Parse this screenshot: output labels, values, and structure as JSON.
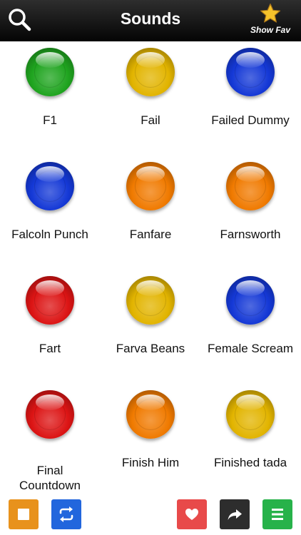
{
  "header": {
    "title": "Sounds",
    "show_fav_label": "Show Fav"
  },
  "colors": {
    "green": "#1fa41f",
    "yellow": "#e2b400",
    "blue": "#1438d6",
    "orange": "#f07a00",
    "red": "#dc1414",
    "stop_button": "#e8921c",
    "repeat_button": "#2266dd",
    "favorite_button": "#e84a4a",
    "share_button": "#2d2d2d",
    "menu_button": "#27b24a"
  },
  "sounds": [
    {
      "name": "F1",
      "color": "green"
    },
    {
      "name": "Fail",
      "color": "yellow"
    },
    {
      "name": "Failed Dummy",
      "color": "blue"
    },
    {
      "name": "Falcoln Punch",
      "color": "blue"
    },
    {
      "name": "Fanfare",
      "color": "orange"
    },
    {
      "name": "Farnsworth",
      "color": "orange"
    },
    {
      "name": "Fart",
      "color": "red"
    },
    {
      "name": "Farva Beans",
      "color": "yellow"
    },
    {
      "name": "Female Scream",
      "color": "blue"
    },
    {
      "name": "Final Countdown",
      "color": "red"
    },
    {
      "name": "Finish Him",
      "color": "orange"
    },
    {
      "name": "Finished tada",
      "color": "yellow"
    }
  ],
  "toolbar": {
    "stop_icon": "stop-icon",
    "repeat_icon": "repeat-icon",
    "favorite_icon": "heart-icon",
    "share_icon": "share-arrow-icon",
    "menu_icon": "menu-icon"
  }
}
